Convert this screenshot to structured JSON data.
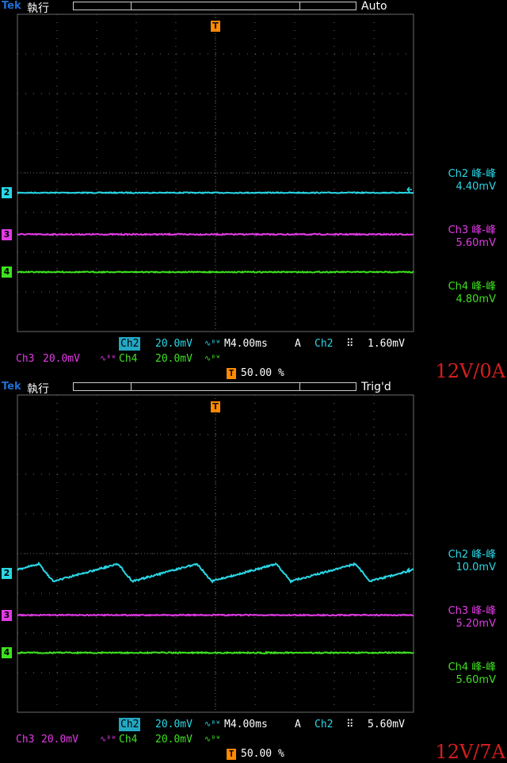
{
  "colors": {
    "ch2": "#29d8e6",
    "ch3": "#e23be6",
    "ch4": "#3ee21f",
    "grid": "#6b6b6b",
    "trigger": "#ff8a00",
    "condition": "#d41e1e"
  },
  "panels": [
    {
      "brand": "Tek",
      "run_state": "執行",
      "trigger_mode": "Auto",
      "trigger_marker": "T",
      "condition_label": "12V/0A",
      "measurements": [
        {
          "name": "Ch2 峰-峰",
          "value": "4.40mV",
          "color": "#29d8e6"
        },
        {
          "name": "Ch3 峰-峰",
          "value": "5.60mV",
          "color": "#e23be6"
        },
        {
          "name": "Ch4 峰-峰",
          "value": "4.80mV",
          "color": "#3ee21f"
        }
      ],
      "status": {
        "ch2_label": "Ch2",
        "ch2_scale": "20.0mV",
        "ch3_label": "Ch3",
        "ch3_scale": "20.0mV",
        "ch4_label": "Ch4",
        "ch4_scale": "20.0mV",
        "bw_icon": "∿ᴮᵂ",
        "timebase": "M4.00ms",
        "acq_mode": "A",
        "trig_source": "Ch2",
        "trig_slope": "rising-edge-icon",
        "trig_level": "1.60mV",
        "trig_position": "50.00 %"
      }
    },
    {
      "brand": "Tek",
      "run_state": "執行",
      "trigger_mode": "Trig'd",
      "trigger_marker": "T",
      "condition_label": "12V/7A",
      "measurements": [
        {
          "name": "Ch2 峰-峰",
          "value": "10.0mV",
          "color": "#29d8e6"
        },
        {
          "name": "Ch3 峰-峰",
          "value": "5.20mV",
          "color": "#e23be6"
        },
        {
          "name": "Ch4 峰-峰",
          "value": "5.60mV",
          "color": "#3ee21f"
        }
      ],
      "status": {
        "ch2_label": "Ch2",
        "ch2_scale": "20.0mV",
        "ch3_label": "Ch3",
        "ch3_scale": "20.0mV",
        "ch4_label": "Ch4",
        "ch4_scale": "20.0mV",
        "bw_icon": "∿ᴮᵂ",
        "timebase": "M4.00ms",
        "acq_mode": "A",
        "trig_source": "Ch2",
        "trig_slope": "rising-edge-icon",
        "trig_level": "5.60mV",
        "trig_position": "50.00 %"
      }
    }
  ],
  "chart_data": [
    {
      "type": "line",
      "grid": true,
      "x_divisions": 10,
      "y_divisions": 8,
      "series": [
        {
          "name": "2",
          "color": "#29d8e6",
          "level_div": 3.0,
          "ripple_pp_mV": 4.4,
          "waveform": "flat"
        },
        {
          "name": "3",
          "color": "#e23be6",
          "level_div": 1.95,
          "ripple_pp_mV": 5.6,
          "waveform": "flat"
        },
        {
          "name": "4",
          "color": "#3ee21f",
          "level_div": 1.0,
          "ripple_pp_mV": 4.8,
          "waveform": "flat"
        }
      ]
    },
    {
      "type": "line",
      "grid": true,
      "x_divisions": 10,
      "y_divisions": 8,
      "series": [
        {
          "name": "2",
          "color": "#29d8e6",
          "level_div": 3.0,
          "ripple_pp_mV": 10.0,
          "waveform": "sawtooth",
          "cycles": 5
        },
        {
          "name": "3",
          "color": "#e23be6",
          "level_div": 1.95,
          "ripple_pp_mV": 5.2,
          "waveform": "flat"
        },
        {
          "name": "4",
          "color": "#3ee21f",
          "level_div": 1.0,
          "ripple_pp_mV": 5.6,
          "waveform": "flat"
        }
      ]
    }
  ]
}
